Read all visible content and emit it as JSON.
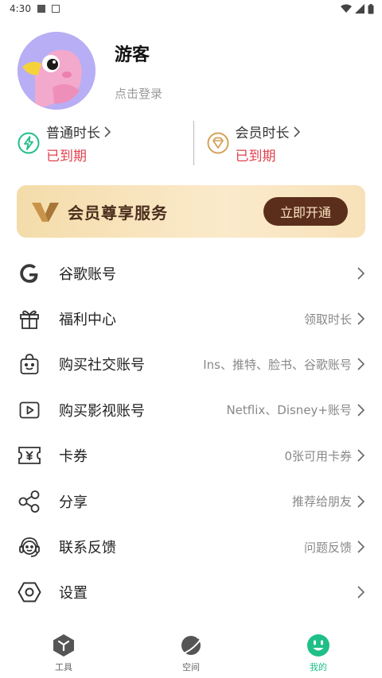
{
  "statusbar": {
    "time": "4:30"
  },
  "profile": {
    "name": "游客",
    "login": "点击登录"
  },
  "durations": [
    {
      "title": "普通时长",
      "status": "已到期"
    },
    {
      "title": "会员时长",
      "status": "已到期"
    }
  ],
  "vip": {
    "title": "会员尊享服务",
    "button": "立即开通"
  },
  "menu": [
    {
      "label": "谷歌账号",
      "value": "",
      "icon": "google-icon"
    },
    {
      "label": "福利中心",
      "value": "领取时长",
      "icon": "gift-icon"
    },
    {
      "label": "购买社交账号",
      "value": "Ins、推特、脸书、谷歌账号",
      "icon": "shopping-bag-icon"
    },
    {
      "label": "购买影视账号",
      "value": "Netflix、Disney+账号",
      "icon": "play-icon"
    },
    {
      "label": "卡券",
      "value": "0张可用卡券",
      "icon": "coupon-icon"
    },
    {
      "label": "分享",
      "value": "推荐给朋友",
      "icon": "share-icon"
    },
    {
      "label": "联系反馈",
      "value": "问题反馈",
      "icon": "headset-icon"
    },
    {
      "label": "设置",
      "value": "",
      "icon": "settings-icon"
    }
  ],
  "tabs": [
    {
      "label": "工具",
      "icon": "tools-icon",
      "active": false
    },
    {
      "label": "空间",
      "icon": "planet-icon",
      "active": false
    },
    {
      "label": "我的",
      "icon": "smiley-icon",
      "active": true
    }
  ],
  "colors": {
    "accent": "#1fbf87",
    "expired": "#e0424e",
    "vip_button": "#5b2e1c"
  }
}
